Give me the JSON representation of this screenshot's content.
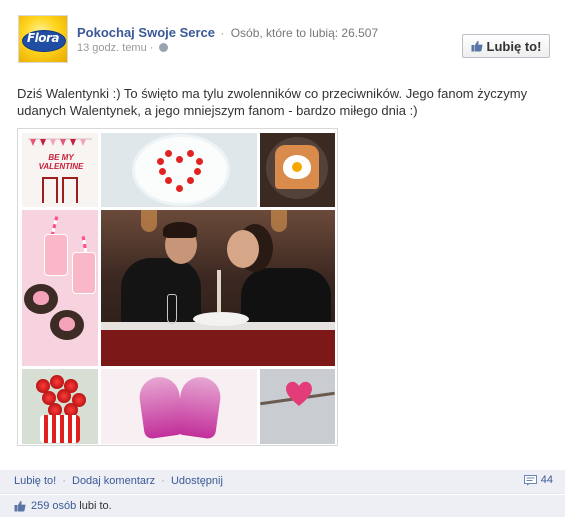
{
  "header": {
    "logo_text": "Flora",
    "page_name": "Pokochaj Swoje Serce",
    "separator": "·",
    "fans_label": "Osób, które to lubią: 26.507",
    "time": "13 godz. temu",
    "time_separator": "·",
    "like_page_button": "Lubię to!"
  },
  "post": {
    "text": "Dziś Walentynki :) To święto ma tylu zwolenników co przeciwników. Jego fanom życzymy udanych Walentynek, a jego mniejszym fanom - bardzo miłego dnia :)"
  },
  "collage": {
    "tile1_text": "BE MY VALENTINE"
  },
  "footer": {
    "actions": {
      "like": "Lubię to!",
      "comment": "Dodaj komentarz",
      "share": "Udostępnij",
      "separator": "·"
    },
    "comments_count": "44",
    "likes_count_link": "259 osób",
    "likes_suffix": "lubi to."
  },
  "colors": {
    "link": "#3b5998",
    "footer_bg": "#edeff4",
    "logo_yellow": "#ffd51e",
    "logo_blue": "#1f4ea3"
  },
  "icons": [
    "flora-logo",
    "globe-icon",
    "thumbs-up-icon",
    "comment-icon"
  ]
}
